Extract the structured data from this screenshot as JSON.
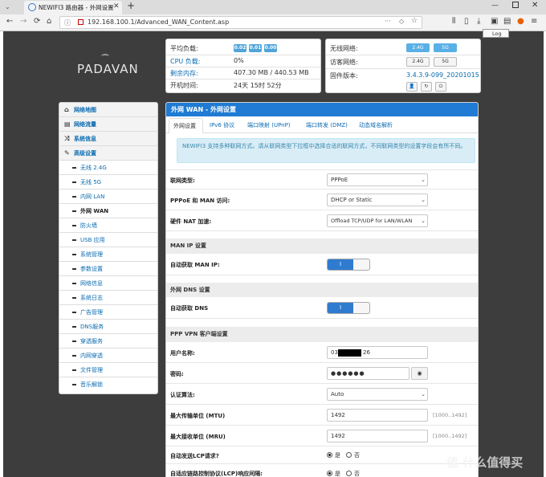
{
  "browser": {
    "tab_title": "NEWIFI3 路由器 - 外网设置",
    "new_tab": "+",
    "url": "192.168.100.1/Advanced_WAN_Content.asp",
    "tooltip": "Log"
  },
  "logo": "PADAVAN",
  "status": {
    "load_label": "平均负载:",
    "load_values": [
      "0.02",
      "0.01",
      "0.00"
    ],
    "cpu_label": "CPU 负载:",
    "cpu_value": "0%",
    "mem_label": "剩余内存:",
    "mem_value": "407.30 MB / 440.53 MB",
    "uptime_label": "开机时间:",
    "uptime_value": "24天 15时 52分",
    "wifi_label": "无线网络:",
    "guest_label": "访客网络:",
    "band_24": "2.4G",
    "band_5": "5G",
    "fw_label": "固件版本:",
    "fw_value": "3.4.3.9-099_20201015"
  },
  "sidebar": {
    "items": [
      {
        "label": "网络地图",
        "icon": "home-icon"
      },
      {
        "label": "网络流量",
        "icon": "chart-icon"
      },
      {
        "label": "系统信息",
        "icon": "shuffle-icon"
      },
      {
        "label": "高级设置",
        "icon": "wrench-icon"
      }
    ],
    "subitems": [
      "无线 2.4G",
      "无线 5G",
      "内网 LAN",
      "外网 WAN",
      "防火墙",
      "USB 应用",
      "系统管理",
      "参数设置",
      "网络信息",
      "系统日志",
      "广告管理",
      "DNS服务",
      "穿透服务",
      "内网穿透",
      "文件管理",
      "音乐解锁"
    ]
  },
  "main": {
    "title": "外网 WAN - 外网设置",
    "tabs": [
      "外网设置",
      "IPv6 协议",
      "端口映射 (UPnP)",
      "端口转发 (DMZ)",
      "动态域名解析"
    ],
    "info": "NEWIFI3 支持多种联网方式。请从联网类型下拉框中选择合适的联网方式，不同联网类型的设置字段会有所不同。",
    "conn_type_label": "联网类型:",
    "conn_type_value": "PPPoE",
    "man_access_label": "PPPoE 和 MAN 访问:",
    "man_access_value": "DHCP or Static",
    "nat_label": "硬件 NAT 加速:",
    "nat_value": "Offload TCP/UDP for LAN/WLAN",
    "man_ip_section": "MAN IP 设置",
    "auto_ip_label": "自动获取 MAN IP:",
    "dns_section": "外网 DNS 设置",
    "auto_dns_label": "自动获取 DNS",
    "toggle_on": "I",
    "ppp_section": "PPP VPN 客户端设置",
    "user_label": "用户名称:",
    "user_prefix": "03",
    "user_suffix": "26",
    "pass_label": "密码:",
    "pass_value": "●●●●●●",
    "auth_label": "认证算法:",
    "auth_value": "Auto",
    "mtu_label": "最大传输单位 (MTU)",
    "mtu_value": "1492",
    "mtu_hint": "[1000..1492]",
    "mru_label": "最大接收单位 (MRU)",
    "mru_value": "1492",
    "mru_hint": "[1000..1492]",
    "lcp_label": "自动发送LCP请求?",
    "yes": "是",
    "no": "否",
    "lcp2_label": "自适应链路控制协议(LCP)响应间隔:"
  },
  "watermark": "值 什么值得买"
}
